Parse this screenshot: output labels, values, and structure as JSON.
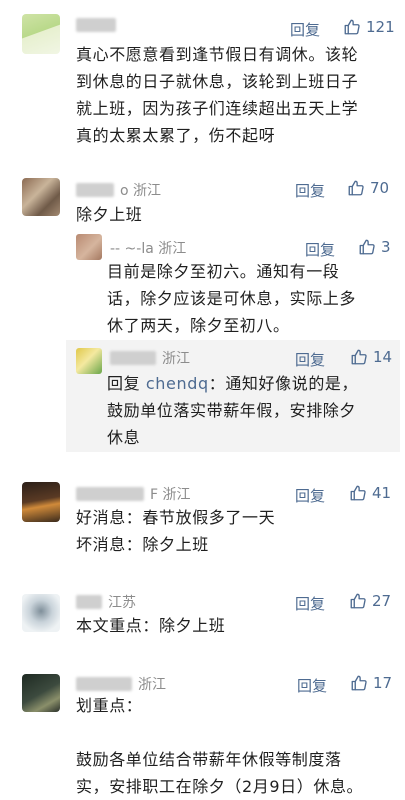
{
  "comments": [
    {
      "location": "",
      "reply_label": "回复",
      "likes": "121",
      "lines": [
        "真心不愿意看到逢节假日有调休。该轮",
        "到休息的日子就休息，该轮到上班日子",
        "就上班，因为孩子们连续超出五天上学",
        "真的太累太累了，伤不起呀"
      ]
    },
    {
      "location": "o 浙江",
      "reply_label": "回复",
      "likes": "70",
      "lines": [
        "除夕上班"
      ]
    },
    {
      "location": "-- ~-la 浙江",
      "reply_label": "回复",
      "likes": "3",
      "lines": [
        "目前是除夕至初六。通知有一段",
        "话，除夕应该是可休息，实际上多",
        "休了两天，除夕至初八。"
      ]
    },
    {
      "location": "浙江",
      "reply_label": "回复",
      "likes": "14",
      "reply_prefix": "回复 ",
      "reply_target": "chendq",
      "lines": [
        "：通知好像说的是，",
        "鼓励单位落实带薪年假，安排除夕",
        "休息"
      ]
    },
    {
      "location": "F 浙江",
      "reply_label": "回复",
      "likes": "41",
      "lines": [
        "好消息：春节放假多了一天",
        "坏消息：除夕上班"
      ]
    },
    {
      "location": "江苏",
      "reply_label": "回复",
      "likes": "27",
      "lines": [
        "本文重点：除夕上班"
      ]
    },
    {
      "location": "浙江",
      "reply_label": "回复",
      "likes": "17",
      "lines": [
        "划重点：",
        "",
        "鼓励各单位结合带薪年休假等制度落",
        "实，安排职工在除夕（2月9日）休息。"
      ]
    }
  ],
  "colors": {
    "link": "#4e6b91",
    "meta": "#8c8c8c",
    "text": "#1f1f1f",
    "quote_bg": "#f3f3f3"
  },
  "icons": {
    "like": "thumbs-up-icon"
  }
}
